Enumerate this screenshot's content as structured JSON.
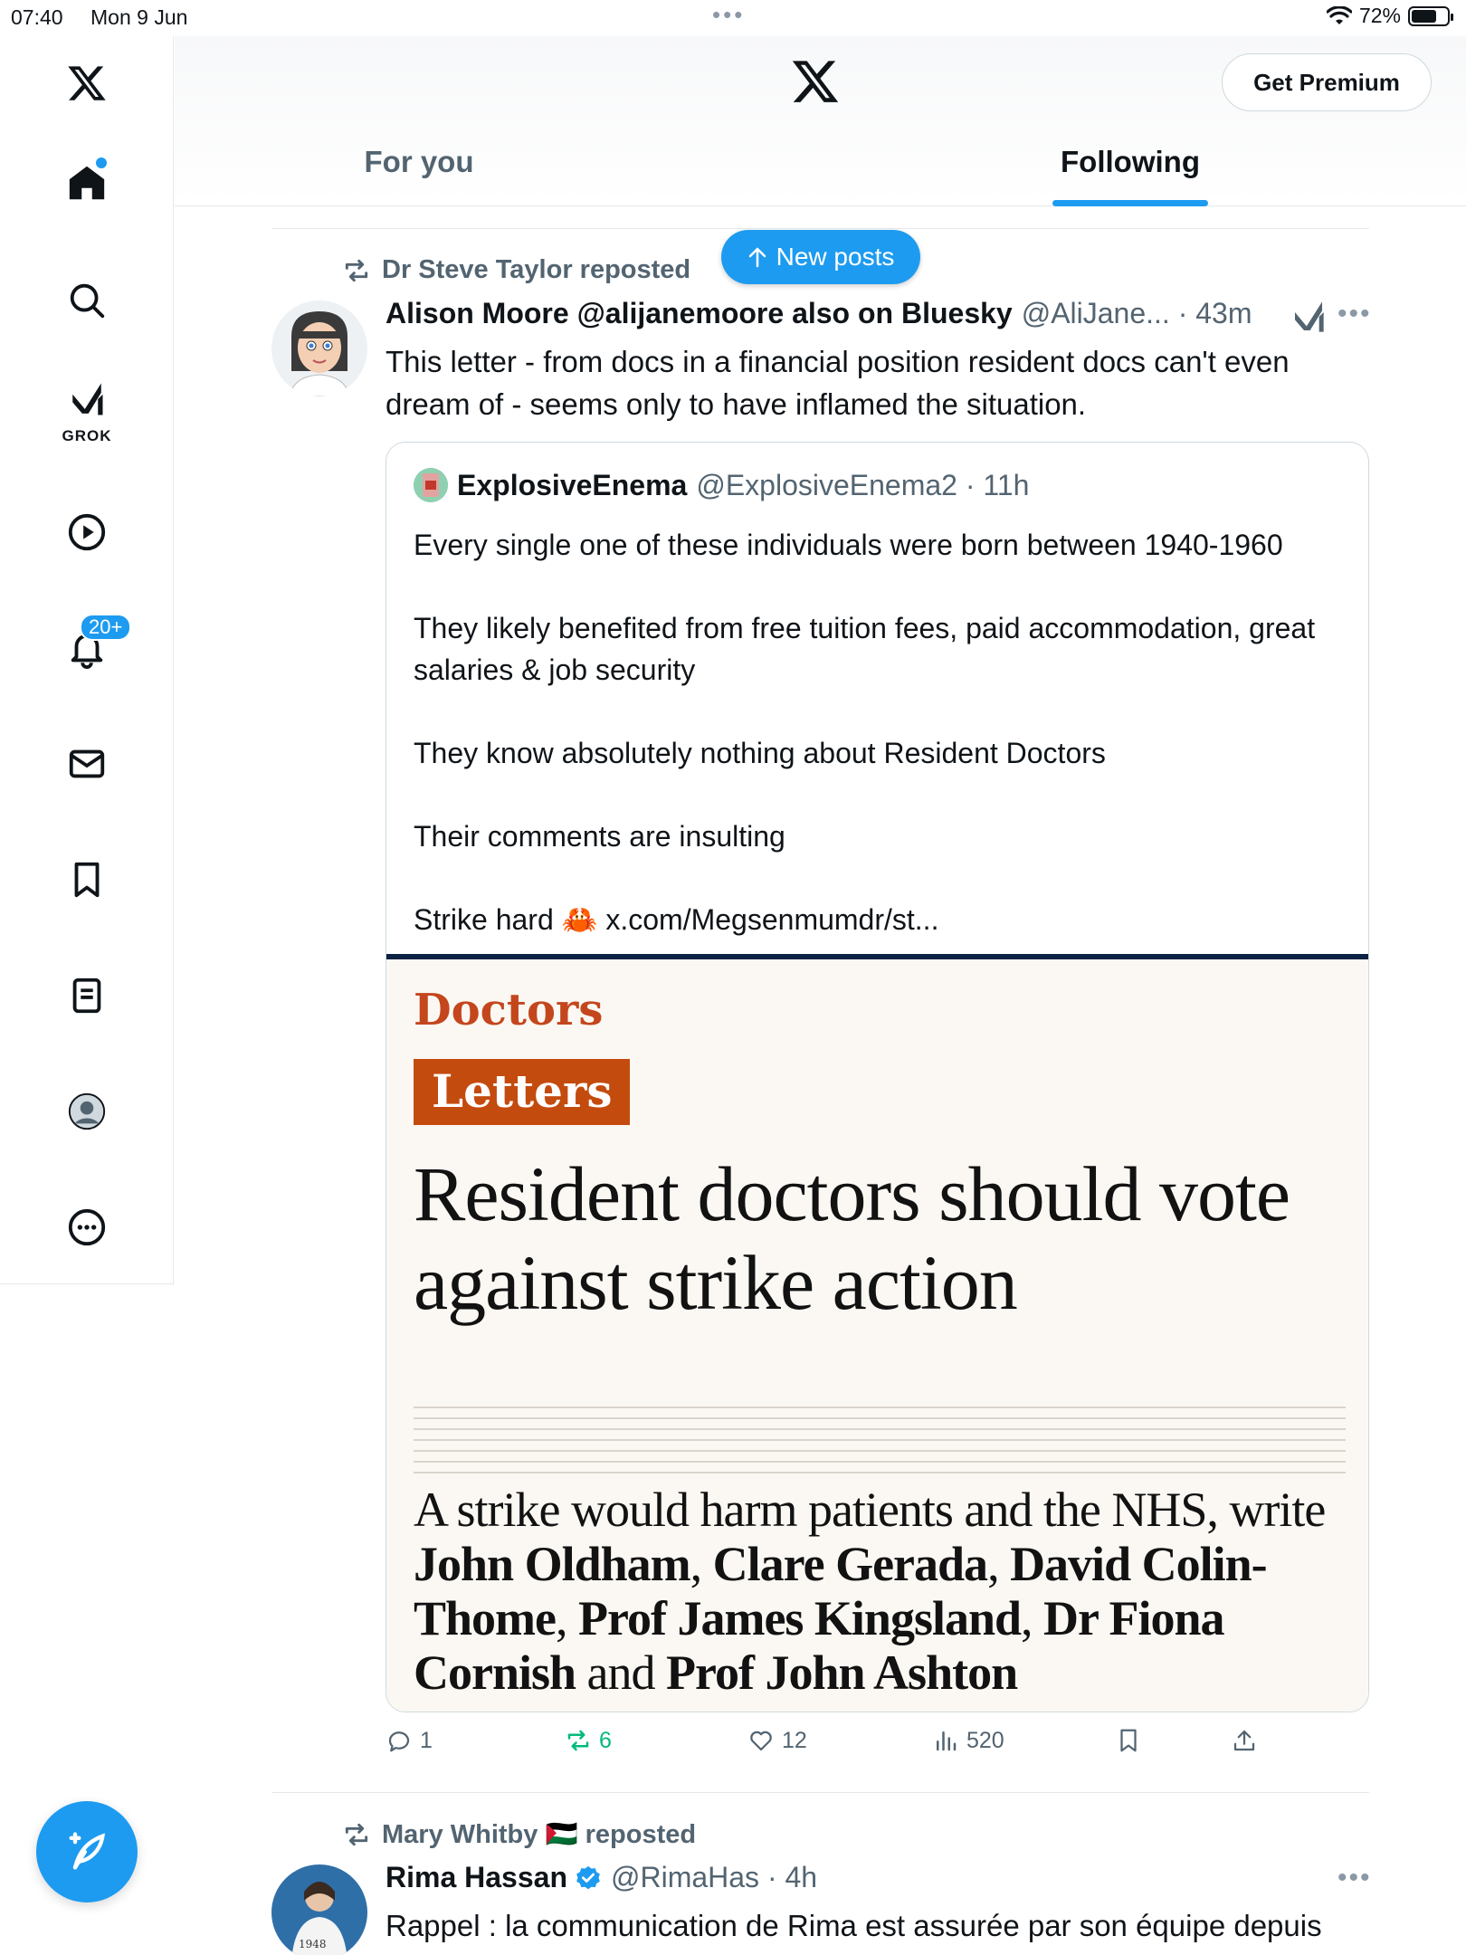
{
  "status_bar": {
    "time": "07:40",
    "date": "Mon 9 Jun",
    "battery": "72%",
    "battery_level": 0.72
  },
  "sidebar": {
    "items": [
      {
        "icon": "x-logo-icon"
      },
      {
        "icon": "home-icon",
        "has_dot": true
      },
      {
        "icon": "search-icon"
      },
      {
        "icon": "grok-icon",
        "label": "GROK"
      },
      {
        "icon": "play-icon"
      },
      {
        "icon": "bell-icon",
        "badge": "20+"
      },
      {
        "icon": "mail-icon"
      },
      {
        "icon": "bookmark-icon"
      },
      {
        "icon": "list-icon"
      },
      {
        "icon": "profile-icon"
      },
      {
        "icon": "more-icon"
      }
    ],
    "compose_icon": "compose-feather-icon"
  },
  "header": {
    "premium_label": "Get Premium",
    "tabs": [
      {
        "label": "For you",
        "active": false
      },
      {
        "label": "Following",
        "active": true
      }
    ]
  },
  "new_posts_label": "New posts",
  "tweets": [
    {
      "repost_by": "Dr Steve Taylor reposted",
      "author_name": "Alison Moore @alijanemoore also on Bluesky",
      "author_meta": "@AliJane... · 43m",
      "text": "This letter - from docs in a financial position resident docs can't even dream of - seems only to have inflamed the situation.",
      "quote": {
        "author_name": "ExplosiveEnema",
        "author_meta": "@ExplosiveEnema2 · 11h",
        "paragraphs": [
          "Every single one of these individuals were born between 1940-1960",
          "They likely benefited from free tuition fees, paid accommodation, great salaries & job security",
          "They know absolutely nothing about Resident Doctors",
          "Their comments are insulting",
          "Strike hard 🦀 x.com/Megsenmumdr/st..."
        ],
        "image": {
          "section": "Doctors",
          "tag": "Letters",
          "headline": "Resident doctors should vote against strike action",
          "standfirst_pre": "A strike would harm patients and the NHS, write ",
          "names": [
            "John Oldham",
            "Clare Gerada",
            "David Colin-Thome",
            "Prof James Kingsland",
            "Dr Fiona Cornish",
            "Prof John Ashton"
          ]
        }
      },
      "actions": {
        "replies": "1",
        "reposts": "6",
        "likes": "12",
        "views": "520"
      }
    },
    {
      "repost_by": "Mary Whitby 🇵🇸 reposted",
      "author_name": "Rima Hassan",
      "author_meta": "@RimaHas · 4h",
      "text": "Rappel : la communication de Rima est assurée par son équipe depuis"
    }
  ],
  "colors": {
    "accent": "#1d9bf0",
    "text": "#0f1419",
    "muted": "#536471",
    "repost_green": "#00ba7c",
    "guardian_orange": "#c44b0e",
    "guardian_navy": "#0b2243"
  }
}
